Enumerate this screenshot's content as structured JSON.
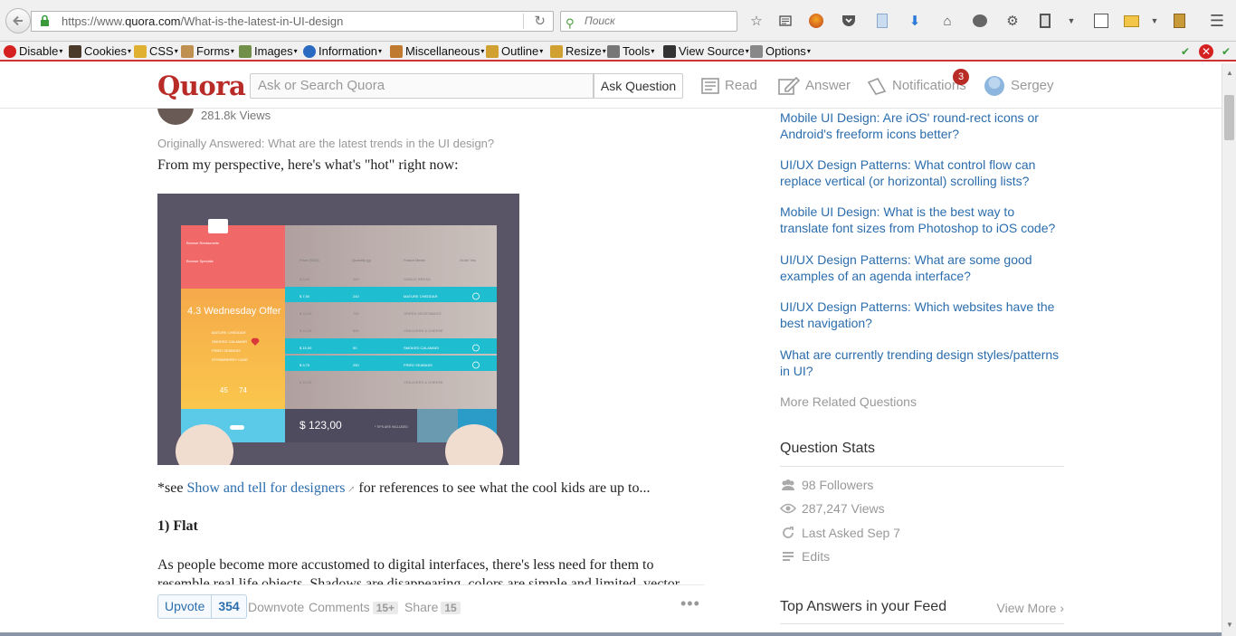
{
  "browser": {
    "url_prefix": "https://www.",
    "url_domain": "quora.com",
    "url_path": "/What-is-the-latest-in-UI-design",
    "search_placeholder": "Поиск",
    "icons": [
      "star-icon",
      "reading-list-icon",
      "avatar-addon-icon",
      "pocket-icon",
      "bookmark-panel-icon",
      "download-icon",
      "home-icon",
      "chat-icon",
      "addon-icon",
      "clipboard-icon",
      "menu-caret-icon",
      "screenshot-icon",
      "folder-icon",
      "notes-icon",
      "hamburger-menu-icon"
    ]
  },
  "devtoolbar": {
    "items": [
      {
        "label": "Disable",
        "icon": "disable-icon",
        "color": "#d42020"
      },
      {
        "label": "Cookies",
        "icon": "cookies-icon",
        "color": "#4a3a2a"
      },
      {
        "label": "CSS",
        "icon": "css-icon",
        "color": "#e0b030"
      },
      {
        "label": "Forms",
        "icon": "forms-icon",
        "color": "#c09050"
      },
      {
        "label": "Images",
        "icon": "images-icon",
        "color": "#70904a"
      },
      {
        "label": "Information",
        "icon": "information-icon",
        "color": "#2a6ac0"
      },
      {
        "label": "Miscellaneous",
        "icon": "miscellaneous-icon",
        "color": "#c07a30"
      },
      {
        "label": "Outline",
        "icon": "outline-icon",
        "color": "#d0a030"
      },
      {
        "label": "Resize",
        "icon": "resize-icon",
        "color": "#d0a030"
      },
      {
        "label": "Tools",
        "icon": "tools-icon",
        "color": "#777777"
      },
      {
        "label": "View Source",
        "icon": "view-source-icon",
        "color": "#333333"
      },
      {
        "label": "Options",
        "icon": "options-icon",
        "color": "#888888"
      }
    ]
  },
  "quora": {
    "logo": "Quora",
    "search_placeholder": "Ask or Search Quora",
    "ask_label": "Ask Question",
    "nav": {
      "read": "Read",
      "answer": "Answer",
      "notifications": "Notifications",
      "notif_count": "3",
      "user": "Sergey"
    },
    "brand_color": "#b92b27"
  },
  "answer": {
    "views": "281.8k Views",
    "originally": "Originally Answered: What are the latest trends in the UI design?",
    "intro": "From my perspective, here's what's \"hot\" right now:",
    "see_prefix": "*see ",
    "see_link": "Show and tell for designers",
    "see_suffix": " for references to see what the cool kids are up to...",
    "heading_flat": "1) Flat",
    "para": "As people become more accustomed to digital interfaces, there's less need for them to resemble real life objects. Shadows are disappearing, colors are simple and limited, vector"
  },
  "hero_image": {
    "menu_items": [
      "Browse Restaurants",
      "Browse Specials"
    ],
    "offer_title": "4.3 Wednesday Offer",
    "offer_items": [
      "MATURE CHEDDAR",
      "SMOKED CALAMARI",
      "FRIED SEABASS",
      "STRAWBERRY CAKE"
    ],
    "likes": "45",
    "users": "74",
    "columns": [
      "Price (SGD)",
      "Quantity (g)",
      "Fusion Meals",
      "Order Yes"
    ],
    "rows": [
      {
        "price": "$ 5,00",
        "qty": "250",
        "meal": "GARLIC BREAD",
        "hl": false
      },
      {
        "price": "$ 7,50",
        "qty": "240",
        "meal": "MATURE CHEDDAR",
        "hl": true
      },
      {
        "price": "$ 10,00",
        "qty": "750",
        "meal": "GREEN VEGETABLES",
        "hl": false
      },
      {
        "price": "$ 10,25",
        "qty": "500",
        "meal": "CRACKERS & CHEESE",
        "hl": false
      },
      {
        "price": "$ 15,00",
        "qty": "90",
        "meal": "SMOKED CALAMARI",
        "hl": true
      },
      {
        "price": "$ 9,75",
        "qty": "250",
        "meal": "FRIED SEABASS",
        "hl": true
      },
      {
        "price": "$ 10,25",
        "qty": "",
        "meal": "CRACKERS & CHEESE",
        "hl": false
      }
    ],
    "total": "$ 123,00",
    "tips_note": "* TIPS ARE INCLUDED"
  },
  "actions": {
    "upvote": "Upvote",
    "upvote_count": "354",
    "downvote": "Downvote",
    "comments": "Comments",
    "comments_count": "15+",
    "share": "Share",
    "share_count": "15",
    "more": "•••"
  },
  "sidebar": {
    "related": [
      "Mobile UI Design: Are iOS' round-rect icons or Android's freeform icons better?",
      "UI/UX Design Patterns: What control flow can replace vertical (or horizontal) scrolling lists?",
      "Mobile UI Design: What is the best way to translate font sizes from Photoshop to iOS code?",
      "UI/UX Design Patterns: What are some good examples of an agenda interface?",
      "UI/UX Design Patterns: Which websites have the best navigation?",
      "What are currently trending design styles/patterns in UI?"
    ],
    "more_related": "More Related Questions",
    "stats_title": "Question Stats",
    "stats": [
      {
        "icon": "followers-icon",
        "text": "98 Followers"
      },
      {
        "icon": "views-eye-icon",
        "text": "287,247 Views"
      },
      {
        "icon": "refresh-icon",
        "text": "Last Asked Sep 7"
      },
      {
        "icon": "edits-icon",
        "text": "Edits"
      }
    ],
    "top_answers_title": "Top Answers in your Feed",
    "view_more": "View More"
  }
}
